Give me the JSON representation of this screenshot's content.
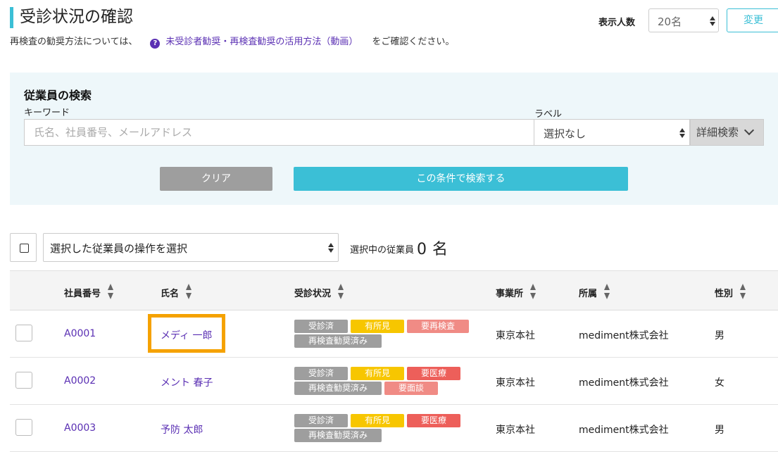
{
  "header": {
    "title": "受診状況の確認",
    "subtitle_prefix": "再検査の勧奨方法については、",
    "help_icon": "?",
    "link_text": "未受診者勧奨・再検査勧奨の活用方法（動画）",
    "subtitle_suffix": "をご確認ください。",
    "display_count_label": "表示人数",
    "display_count_value": "20名",
    "change_button": "変更"
  },
  "search": {
    "title": "従業員の検索",
    "keyword_label": "キーワード",
    "keyword_placeholder": "氏名、社員番号、メールアドレス",
    "label_label": "ラベル",
    "label_value": "選択なし",
    "detail_button": "詳細検索",
    "clear_button": "クリア",
    "search_button": "この条件で検索する"
  },
  "actions": {
    "operation_select": "選択した従業員の操作を選択",
    "selected_label": "選択中の従業員",
    "selected_count": "0",
    "selected_unit": "名"
  },
  "table": {
    "columns": [
      "社員番号",
      "氏名",
      "受診状況",
      "事業所",
      "所属",
      "性別"
    ],
    "rows": [
      {
        "id": "A0001",
        "name": "メディ 一郎",
        "office": "東京本社",
        "dept": "mediment株式会社",
        "gender": "男",
        "tags": [
          {
            "text": "受診済",
            "color": "#9e9e9e",
            "width": 76
          },
          {
            "text": "有所見",
            "color": "#f7c600",
            "width": 76
          },
          {
            "text": "要再検査",
            "color": "#f08b85",
            "width": 88
          },
          {
            "text": "再検査勧奨済み",
            "color": "#9e9e9e",
            "width": 124
          }
        ]
      },
      {
        "id": "A0002",
        "name": "メント 春子",
        "office": "東京本社",
        "dept": "mediment株式会社",
        "gender": "女",
        "tags": [
          {
            "text": "受診済",
            "color": "#9e9e9e",
            "width": 76
          },
          {
            "text": "有所見",
            "color": "#f7c600",
            "width": 76
          },
          {
            "text": "要医療",
            "color": "#ed5f5a",
            "width": 76
          },
          {
            "text": "再検査勧奨済み",
            "color": "#9e9e9e",
            "width": 124
          },
          {
            "text": "要面談",
            "color": "#f08b85",
            "width": 76
          }
        ]
      },
      {
        "id": "A0003",
        "name": "予防 太郎",
        "office": "東京本社",
        "dept": "mediment株式会社",
        "gender": "男",
        "tags": [
          {
            "text": "受診済",
            "color": "#9e9e9e",
            "width": 76
          },
          {
            "text": "有所見",
            "color": "#f7c600",
            "width": 76
          },
          {
            "text": "要医療",
            "color": "#ed5f5a",
            "width": 76
          },
          {
            "text": "再検査勧奨済み",
            "color": "#9e9e9e",
            "width": 124
          }
        ]
      }
    ]
  },
  "colors": {
    "accent": "#3bbfd6",
    "link": "#5a2fb3",
    "highlight": "#f5a200"
  }
}
